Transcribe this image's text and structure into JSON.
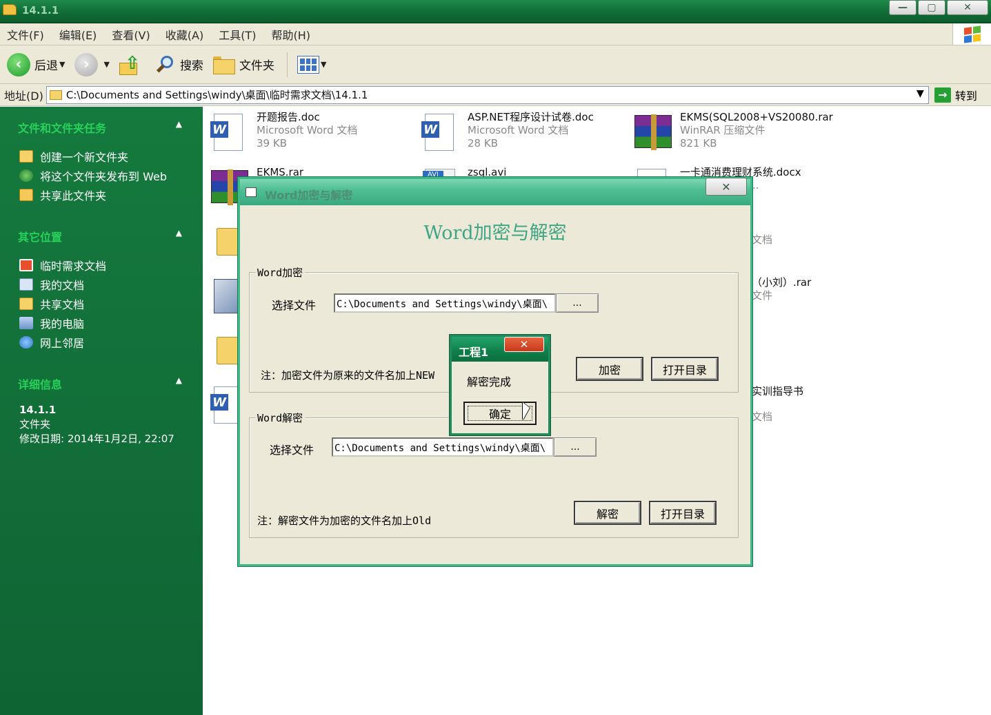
{
  "window": {
    "title": "14.1.1",
    "minimize": "—",
    "maximize": "▢",
    "close": "✕"
  },
  "menu": [
    "文件(F)",
    "编辑(E)",
    "查看(V)",
    "收藏(A)",
    "工具(T)",
    "帮助(H)"
  ],
  "toolbar": {
    "back": "后退",
    "search": "搜索",
    "folders": "文件夹"
  },
  "address": {
    "label": "地址(D)",
    "path": "C:\\Documents and Settings\\windy\\桌面\\临时需求文档\\14.1.1",
    "go": "转到"
  },
  "taskpane": {
    "tasks_title": "文件和文件夹任务",
    "tasks": [
      "创建一个新文件夹",
      "将这个文件夹发布到 Web",
      "共享此文件夹"
    ],
    "places_title": "其它位置",
    "places": [
      "临时需求文档",
      "我的文档",
      "共享文档",
      "我的电脑",
      "网上邻居"
    ],
    "details_title": "详细信息",
    "details_name": "14.1.1",
    "details_type": "文件夹",
    "details_modified": "修改日期: 2014年1月2日, 22:07"
  },
  "files": [
    {
      "name": "开题报告.doc",
      "type": "Microsoft Word 文档",
      "size": "39 KB"
    },
    {
      "name": "ASP.NET程序设计试卷.doc",
      "type": "Microsoft Word 文档",
      "size": "28 KB"
    },
    {
      "name": "EKMS(SQL2008+VS20080.rar",
      "type": "WinRAR 压缩文件",
      "size": "821 KB"
    },
    {
      "name": "EKMS.rar"
    },
    {
      "name": "zsql.avi"
    },
    {
      "name": "一卡通消费理财系统.docx",
      "type": "e Word 2007 ..."
    },
    {
      "type": "文档"
    },
    {
      "name": "（小刘）.rar",
      "type": "文件"
    },
    {
      "name": "实训指导书",
      "type": "文档"
    }
  ],
  "dialog": {
    "title": "Word加密与解密",
    "close": "✕",
    "heading": "Word加密与解密",
    "encrypt": {
      "legend": "Word加密",
      "select_label": "选择文件",
      "path": "C:\\Documents and Settings\\windy\\桌面\\",
      "browse": "...",
      "action": "加密",
      "open_dir": "打开目录",
      "note": "注：加密文件为原来的文件名加上NEW"
    },
    "decrypt": {
      "legend": "Word解密",
      "select_label": "选择文件",
      "path": "C:\\Documents and Settings\\windy\\桌面\\",
      "browse": "...",
      "action": "解密",
      "open_dir": "打开目录",
      "note": "注：解密文件为加密的文件名加上Old"
    }
  },
  "msgbox": {
    "title": "工程1",
    "close": "✕",
    "text": "解密完成",
    "ok": "确定"
  }
}
